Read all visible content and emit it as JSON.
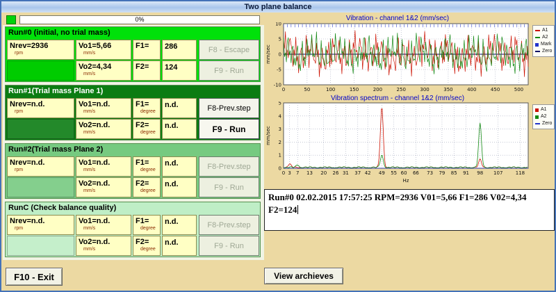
{
  "window": {
    "title": "Two plane balance"
  },
  "progress": {
    "label": "0%",
    "percent": 0
  },
  "runs": [
    {
      "title": "Run#0 (initial, no trial mass)",
      "cells": {
        "nrev": {
          "value": "Nrev=2936",
          "unit": "rpm"
        },
        "vo1": {
          "value": "Vo1=5,66",
          "unit": "mm/s"
        },
        "vo2": {
          "value": "Vo2=4,34",
          "unit": "mm/s"
        },
        "f1": {
          "label": "F1=",
          "value": "286",
          "unit": ""
        },
        "f2": {
          "label": "F2=",
          "value": "124",
          "unit": ""
        }
      },
      "buttons": [
        {
          "label": "F8 - Escape",
          "enabled": false
        },
        {
          "label": "F9 - Run",
          "enabled": false
        }
      ]
    },
    {
      "title": "Run#1(Trial mass Plane 1)",
      "cells": {
        "nrev": {
          "value": "Nrev=n.d.",
          "unit": "rpm"
        },
        "vo1": {
          "value": "Vo1=n.d.",
          "unit": "mm/s"
        },
        "vo2": {
          "value": "Vo2=n.d.",
          "unit": "mm/s"
        },
        "f1": {
          "label": "F1=",
          "value": "n.d.",
          "unit": "degree"
        },
        "f2": {
          "label": "F2=",
          "value": "n.d.",
          "unit": "degree"
        }
      },
      "buttons": [
        {
          "label": "F8-Prev.step",
          "enabled": true
        },
        {
          "label": "F9 - Run",
          "enabled": true
        }
      ]
    },
    {
      "title": "Run#2(Trial mass Plane 2)",
      "cells": {
        "nrev": {
          "value": "Nrev=n.d.",
          "unit": "rpm"
        },
        "vo1": {
          "value": "Vo1=n.d.",
          "unit": "mm/s"
        },
        "vo2": {
          "value": "Vo2=n.d.",
          "unit": "mm/s"
        },
        "f1": {
          "label": "F1=",
          "value": "n.d.",
          "unit": "degree"
        },
        "f2": {
          "label": "F2=",
          "value": "n.d.",
          "unit": "degree"
        }
      },
      "buttons": [
        {
          "label": "F8-Prev.step",
          "enabled": false
        },
        {
          "label": "F9 - Run",
          "enabled": false
        }
      ]
    },
    {
      "title": "RunC (Check balance quality)",
      "cells": {
        "nrev": {
          "value": "Nrev=n.d.",
          "unit": "rpm"
        },
        "vo1": {
          "value": "Vo1=n.d.",
          "unit": "mm/s"
        },
        "vo2": {
          "value": "Vo2=n.d.",
          "unit": "mm/s"
        },
        "f1": {
          "label": "F1=",
          "value": "n.d.",
          "unit": "degree"
        },
        "f2": {
          "label": "F2=",
          "value": "n.d.",
          "unit": "degree"
        }
      },
      "buttons": [
        {
          "label": "F8-Prev.step",
          "enabled": false
        },
        {
          "label": "F9 - Run",
          "enabled": false
        }
      ]
    }
  ],
  "log": {
    "text": "Run#0 02.02.2015 17:57:25 RPM=2936 V01=5,66 F1=286 V02=4,34 F2=124"
  },
  "footer": {
    "exit_button": "F10 - Exit",
    "view_archives_button": "View archieves"
  },
  "colors": {
    "run0_panel": "#00e10a",
    "run1_panel": "#0b7c12",
    "run2_panel": "#76ca80",
    "runc_panel": "#bfeec6",
    "cell_bg": "#ffffc4",
    "window_bg": "#ecd9a2",
    "a1": "#cc1100",
    "a2": "#118811",
    "mark": "#2233cc"
  },
  "chart_data": [
    {
      "type": "line",
      "title": "Vibration - channel 1&2 (mm/sec)",
      "xlabel": "",
      "ylabel": "mm/sec",
      "xlim": [
        0,
        520
      ],
      "ylim": [
        -10,
        10
      ],
      "xticks": [
        0,
        50,
        100,
        150,
        200,
        250,
        300,
        350,
        400,
        450,
        500
      ],
      "yticks": [
        -10,
        -5,
        0,
        5,
        10
      ],
      "grid": true,
      "legend_position": "right",
      "legend": [
        {
          "label": "A1",
          "color": "#cc1100",
          "marker": "dash"
        },
        {
          "label": "A2",
          "color": "#118811",
          "marker": "dash"
        },
        {
          "label": "Mark",
          "color": "#2233cc",
          "marker": "square"
        },
        {
          "label": "Zero",
          "color": "#000066",
          "marker": "dash"
        }
      ],
      "series": [
        {
          "name": "A1",
          "color": "#cc1100",
          "amplitude": 8,
          "components": [
            [
              0.55,
              3.2,
              0
            ],
            [
              1.7,
              2.8,
              1.3
            ],
            [
              0.13,
              1.6,
              0.4
            ],
            [
              3.1,
              0.9,
              2.0
            ]
          ]
        },
        {
          "name": "A2",
          "color": "#118811",
          "amplitude": 8,
          "components": [
            [
              0.62,
              3.0,
              2.1
            ],
            [
              1.9,
              2.5,
              0.2
            ],
            [
              0.11,
              1.8,
              1.1
            ],
            [
              2.7,
              1.0,
              0.8
            ]
          ]
        }
      ]
    },
    {
      "type": "spectrum",
      "title": "Vibration spectrum - channel 1&2 (mm/sec)",
      "xlabel": "Hz",
      "ylabel": "mm/sec",
      "xlim": [
        0,
        122
      ],
      "ylim": [
        0,
        5
      ],
      "xticks": [
        0,
        3,
        7,
        13,
        20,
        26,
        31,
        37,
        42,
        49,
        55,
        60,
        66,
        73,
        79,
        85,
        91,
        98,
        107,
        118
      ],
      "yticks": [
        0,
        1,
        2,
        3,
        4,
        5
      ],
      "grid": true,
      "legend_position": "right",
      "legend": [
        {
          "label": "A1",
          "color": "#cc1100",
          "marker": "square"
        },
        {
          "label": "A2",
          "color": "#118811",
          "marker": "square"
        },
        {
          "label": "Zero",
          "color": "#2233cc",
          "marker": "dash"
        }
      ],
      "series": [
        {
          "name": "A1",
          "color": "#cc1100",
          "peaks": [
            [
              49,
              4.65
            ],
            [
              98,
              0.6
            ],
            [
              3,
              0.25
            ]
          ]
        },
        {
          "name": "A2",
          "color": "#118811",
          "peaks": [
            [
              98,
              3.35
            ],
            [
              49,
              0.95
            ],
            [
              7,
              0.2
            ]
          ]
        }
      ]
    }
  ]
}
